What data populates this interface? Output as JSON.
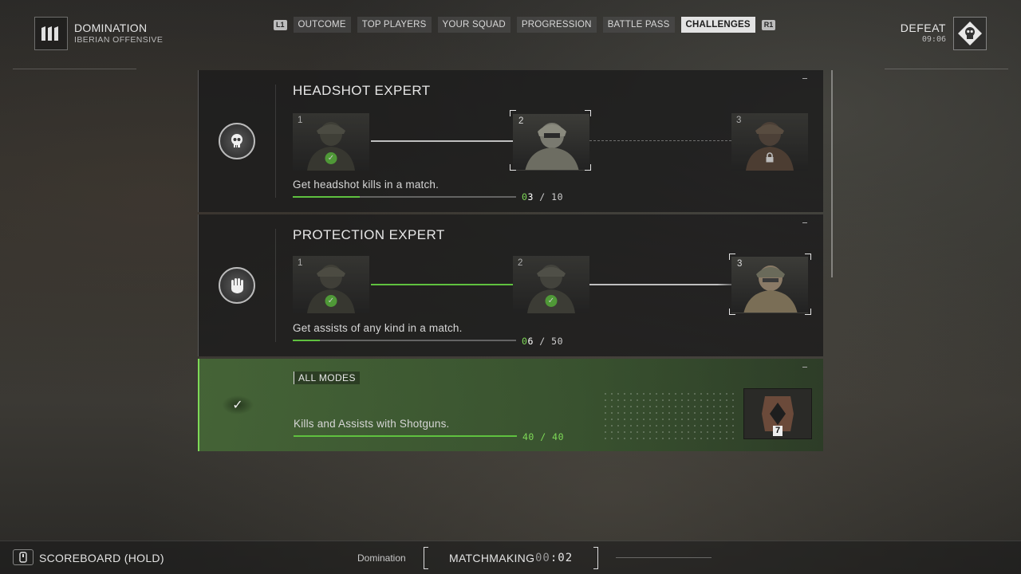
{
  "match": {
    "mode": "DOMINATION",
    "map": "IBERIAN OFFENSIVE",
    "result": "DEFEAT",
    "time": "09:06"
  },
  "tabs": {
    "left_hint": "L1",
    "right_hint": "R1",
    "items": [
      {
        "label": "OUTCOME",
        "active": false
      },
      {
        "label": "TOP PLAYERS",
        "active": false
      },
      {
        "label": "YOUR SQUAD",
        "active": false
      },
      {
        "label": "PROGRESSION",
        "active": false
      },
      {
        "label": "BATTLE PASS",
        "active": false
      },
      {
        "label": "CHALLENGES",
        "active": true
      }
    ]
  },
  "challenges": [
    {
      "title": "HEADSHOT EXPERT",
      "description": "Get headshot kills in a match.",
      "current": "03",
      "current_prefix": "0",
      "current_value": "3",
      "target": "10",
      "progress": 0.3,
      "tiers": [
        {
          "num": "1",
          "state": "done"
        },
        {
          "num": "2",
          "state": "current"
        },
        {
          "num": "3",
          "state": "locked"
        }
      ]
    },
    {
      "title": "PROTECTION EXPERT",
      "description": "Get assists of any kind in a match.",
      "current_prefix": "0",
      "current_value": "6",
      "target": "50",
      "progress": 0.12,
      "tiers": [
        {
          "num": "1",
          "state": "done"
        },
        {
          "num": "2",
          "state": "done"
        },
        {
          "num": "3",
          "state": "current"
        }
      ]
    },
    {
      "tag": "ALL MODES",
      "description": "Kills and Assists with Shotguns.",
      "current_value": "40",
      "target": "40",
      "progress": 1.0,
      "reward_count": "7"
    }
  ],
  "footer": {
    "scoreboard": "SCOREBOARD (HOLD)",
    "mode": "Domination",
    "matchmaking": "MATCHMAKING",
    "mm_time_dim": "00",
    "mm_time_sep": ":",
    "mm_time": "02"
  },
  "colors": {
    "accent": "#5fc13f",
    "complete_panel": "#466937"
  },
  "icons": {
    "mode": "domination-emblem-icon",
    "result": "skull-diamond-icon",
    "headshot": "skull-badge-icon",
    "protection": "hand-shield-badge-icon",
    "complete": "check-icon",
    "reward": "diamond-emblem-icon",
    "scoreboard": "touchpad-icon",
    "lock": "lock-icon"
  }
}
